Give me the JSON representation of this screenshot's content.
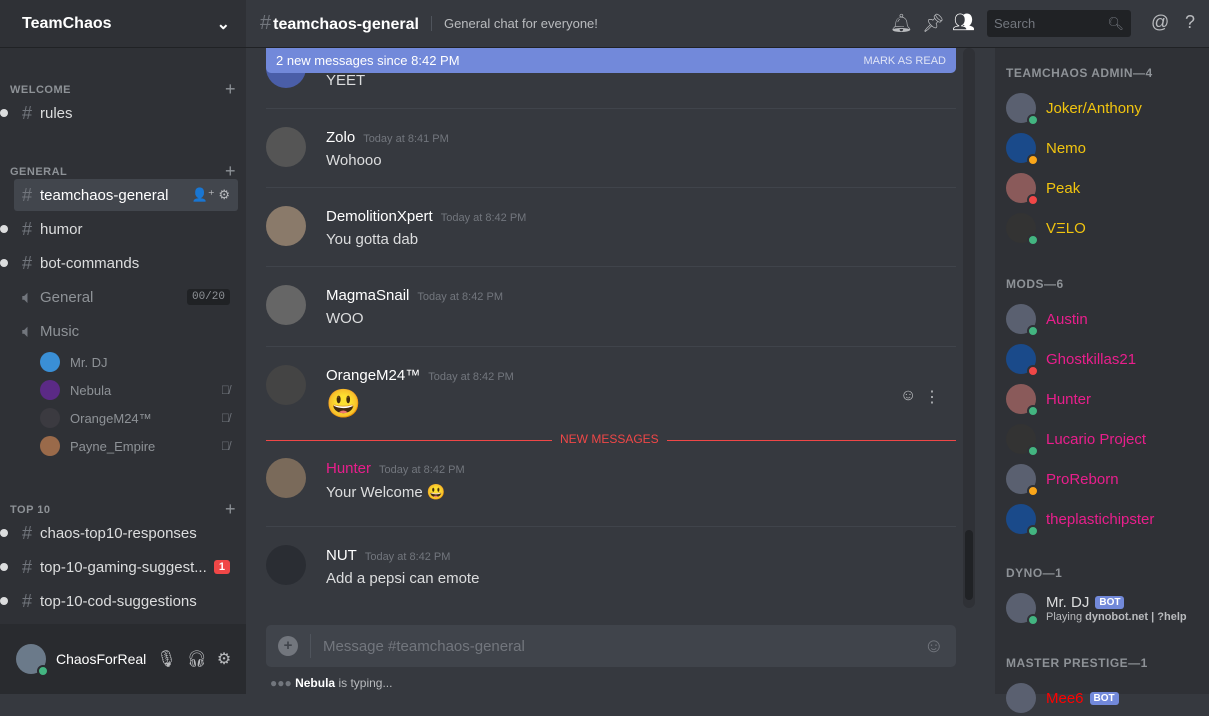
{
  "server": {
    "name": "TeamChaos"
  },
  "categories": [
    {
      "label": "WELCOME"
    },
    {
      "label": "GENERAL"
    },
    {
      "label": "TOP 10"
    }
  ],
  "channels": {
    "rules": "rules",
    "general": "teamchaos-general",
    "humor": "humor",
    "bot": "bot-commands",
    "voice_general": "General",
    "voice_general_count": "00/20",
    "voice_music": "Music",
    "top1": "chaos-top10-responses",
    "top2": "top-10-gaming-suggest...",
    "top2_badge": "1",
    "top3": "top-10-cod-suggestions"
  },
  "voice_users": [
    "Mr. DJ",
    "Nebula",
    "OrangeM24™",
    "Payne_Empire"
  ],
  "user": {
    "name": "ChaosForReal"
  },
  "header": {
    "channel": "teamchaos-general",
    "topic": "General chat for everyone!",
    "search_placeholder": "Search"
  },
  "new_bar": {
    "text": "2 new messages since 8:42 PM",
    "action": "MARK AS READ"
  },
  "messages": [
    {
      "author": "",
      "time": "",
      "text": "YEET"
    },
    {
      "author": "Zolo",
      "time": "Today at 8:41 PM",
      "text": "Wohooo",
      "color": "#ffffff"
    },
    {
      "author": "DemolitionXpert",
      "time": "Today at 8:42 PM",
      "text": "You gotta dab",
      "color": "#ffffff"
    },
    {
      "author": "MagmaSnail",
      "time": "Today at 8:42 PM",
      "text": "WOO",
      "color": "#ffffff"
    },
    {
      "author": "OrangeM24™",
      "time": "Today at 8:42 PM",
      "text": "😃",
      "color": "#ffffff"
    },
    {
      "author": "Hunter",
      "time": "Today at 8:42 PM",
      "text": "Your Welcome 😃",
      "color": "#e91e8c"
    },
    {
      "author": "NUT",
      "time": "Today at 8:42 PM",
      "text": "Add a pepsi can emote",
      "color": "#ffffff"
    }
  ],
  "new_messages_label": "NEW MESSAGES",
  "composer": {
    "placeholder": "Message #teamchaos-general"
  },
  "typing": {
    "user": "Nebula",
    "suffix": " is typing..."
  },
  "member_groups": [
    {
      "label": "TEAMCHAOS ADMIN—4",
      "color": "#f1c40f",
      "members": [
        {
          "name": "Joker/Anthony",
          "status": "online"
        },
        {
          "name": "Nemo",
          "status": "idle"
        },
        {
          "name": "Peak",
          "status": "dnd"
        },
        {
          "name": "VΞLO",
          "status": "online"
        }
      ]
    },
    {
      "label": "MODS—6",
      "color": "#e91e8c",
      "members": [
        {
          "name": "Austin",
          "status": "online"
        },
        {
          "name": "Ghostkillas21",
          "status": "dnd"
        },
        {
          "name": "Hunter",
          "status": "online"
        },
        {
          "name": "Lucario Project",
          "status": "online"
        },
        {
          "name": "ProReborn",
          "status": "idle"
        },
        {
          "name": "theplastichipster",
          "status": "online"
        }
      ]
    },
    {
      "label": "DYNO—1",
      "color": "#dcddde",
      "members": [
        {
          "name": "Mr. DJ",
          "status": "online",
          "bot": "BOT",
          "activity_prefix": "Playing ",
          "activity": "dynobot.net | ?help"
        }
      ]
    },
    {
      "label": "MASTER PRESTIGE—1",
      "color": "#ff0000",
      "members": [
        {
          "name": "Mee6",
          "bot": "BOT"
        }
      ]
    }
  ],
  "status_colors": {
    "online": "#43b581",
    "idle": "#faa61a",
    "dnd": "#f04747"
  }
}
